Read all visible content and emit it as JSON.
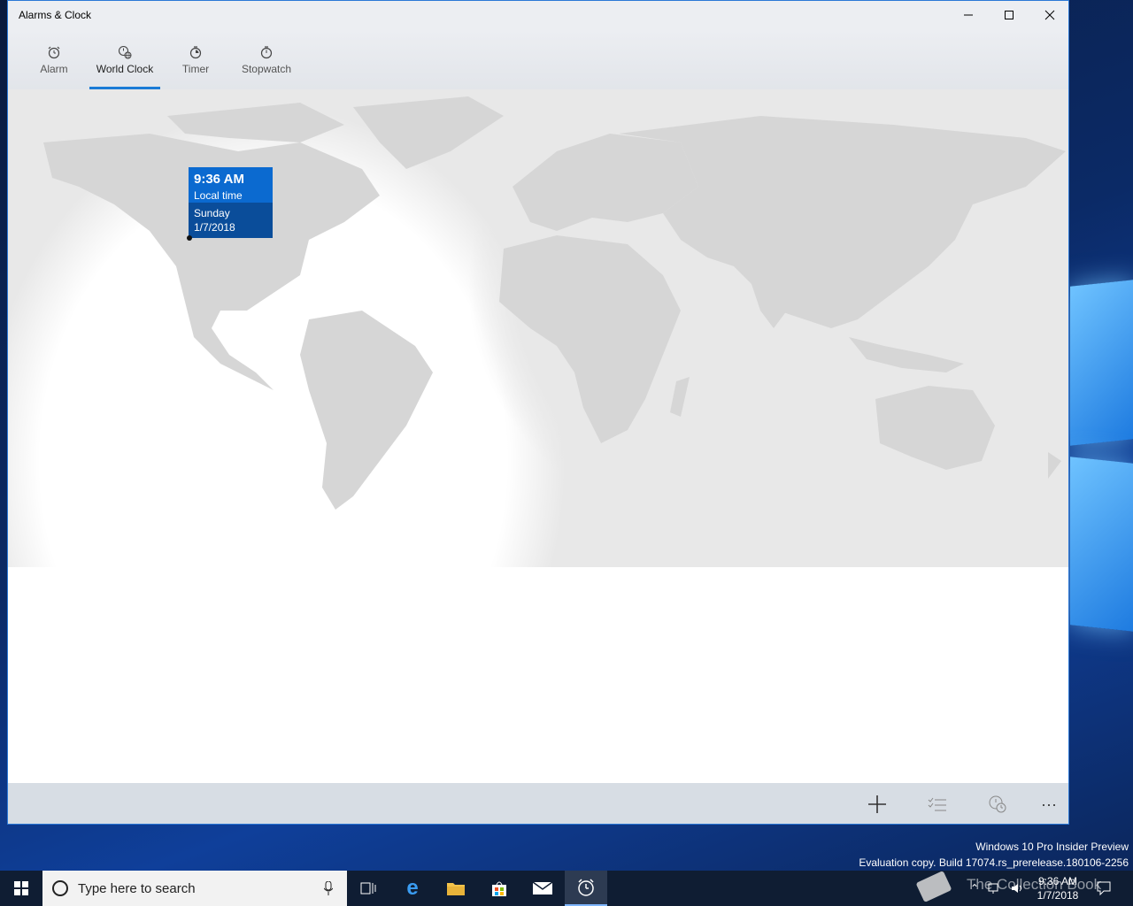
{
  "window": {
    "title": "Alarms & Clock",
    "controls": {
      "minimize": "—",
      "maximize": "☐",
      "close": "✕"
    }
  },
  "tabs": [
    {
      "label": "Alarm",
      "icon": "alarm-icon",
      "active": false
    },
    {
      "label": "World Clock",
      "icon": "world-clock-icon",
      "active": true
    },
    {
      "label": "Timer",
      "icon": "timer-icon",
      "active": false
    },
    {
      "label": "Stopwatch",
      "icon": "stopwatch-icon",
      "active": false
    }
  ],
  "local_pin": {
    "time": "9:36 AM",
    "label": "Local time",
    "day": "Sunday",
    "date": "1/7/2018"
  },
  "command_bar": {
    "buttons": [
      {
        "icon": "add-icon",
        "label": "+"
      },
      {
        "icon": "select-icon"
      },
      {
        "icon": "compare-icon"
      },
      {
        "icon": "more-icon",
        "label": "···"
      }
    ]
  },
  "desktop": {
    "watermark_line1": "Windows 10 Pro Insider Preview",
    "watermark_line2": "Evaluation copy. Build 17074.rs_prerelease.180106-2256",
    "overlay_text": "The Collection Book"
  },
  "taskbar": {
    "search_placeholder": "Type here to search",
    "clock_time": "9:36 AM",
    "clock_date": "1/7/2018"
  },
  "colors": {
    "accent": "#0b6ad0",
    "accent_dark": "#0a4d9a",
    "land": "#d9d9d9",
    "night": "#e8e8e8",
    "taskbar": "#0f1d33"
  }
}
